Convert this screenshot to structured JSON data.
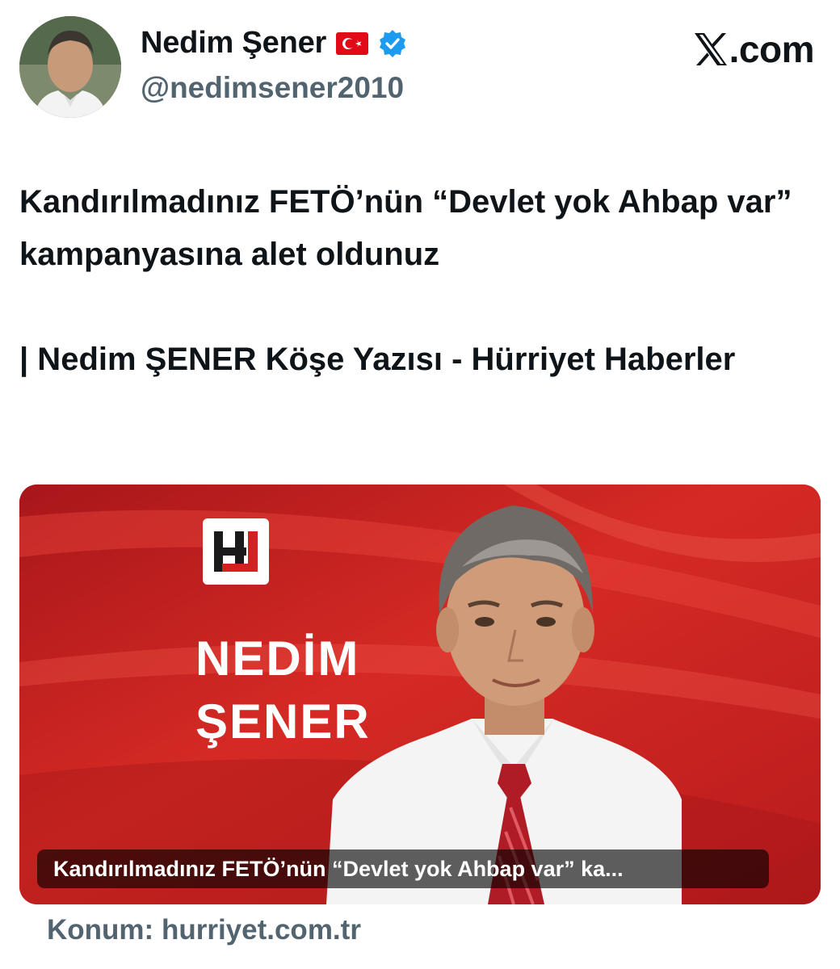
{
  "author": {
    "display_name": "Nedim Şener",
    "handle": "@nedimsener2010",
    "flag_icon": "turkey-flag-icon",
    "verified_icon": "verified-badge-icon"
  },
  "brand": {
    "text": ".com",
    "logo_icon": "x-logo-icon"
  },
  "tweet": {
    "line1": "Kandırılmadınız FETÖ’nün “Devlet yok Ahbap var” kampanyasına alet oldunuz",
    "line2": "| Nedim ŞENER Köşe Yazısı - Hürriyet Haberler"
  },
  "card": {
    "name_line1": "NEDİM",
    "name_line2": "ŞENER",
    "caption": "Kandırılmadınız FETÖ’nün “Devlet yok Ahbap var” ka..."
  },
  "source": {
    "label": "Konum:",
    "domain": "hurriyet.com.tr"
  },
  "colors": {
    "card_red": "#c81f1f",
    "verified_blue": "#1d9bf0",
    "muted": "#536471",
    "text": "#0f1419"
  }
}
